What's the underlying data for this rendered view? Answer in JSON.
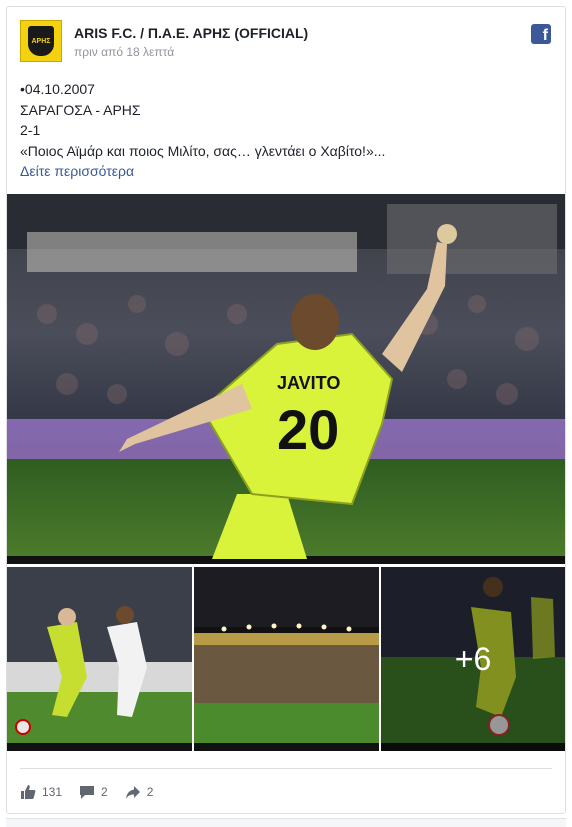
{
  "post": {
    "page_name": "ARIS F.C. / Π.Α.Ε. ΑΡΗΣ (OFFICIAL)",
    "timestamp": "πριν από 18 λεπτά",
    "avatar_text": "ΑΡΗΣ",
    "lines": [
      "•04.10.2007",
      "ΣΑΡΑΓΟΣΑ - ΑΡΗΣ",
      "2-1",
      "«Ποιος Αϊμάρ και ποιος Μιλίτο, σας… γλεντάει ο Χαβίτο!»..."
    ],
    "see_more": "Δείτε περισσότερα"
  },
  "photos": {
    "main_jersey_name": "JAVITO",
    "main_jersey_number": "20",
    "more_count": "+6"
  },
  "stats": {
    "likes": "131",
    "comments": "2",
    "shares": "2"
  },
  "icons": [
    "facebook-icon",
    "like-icon",
    "comment-icon",
    "share-icon"
  ],
  "colors": {
    "facebook_blue": "#3b5998",
    "link": "#385898",
    "kit_yellow": "#d9f23a"
  }
}
